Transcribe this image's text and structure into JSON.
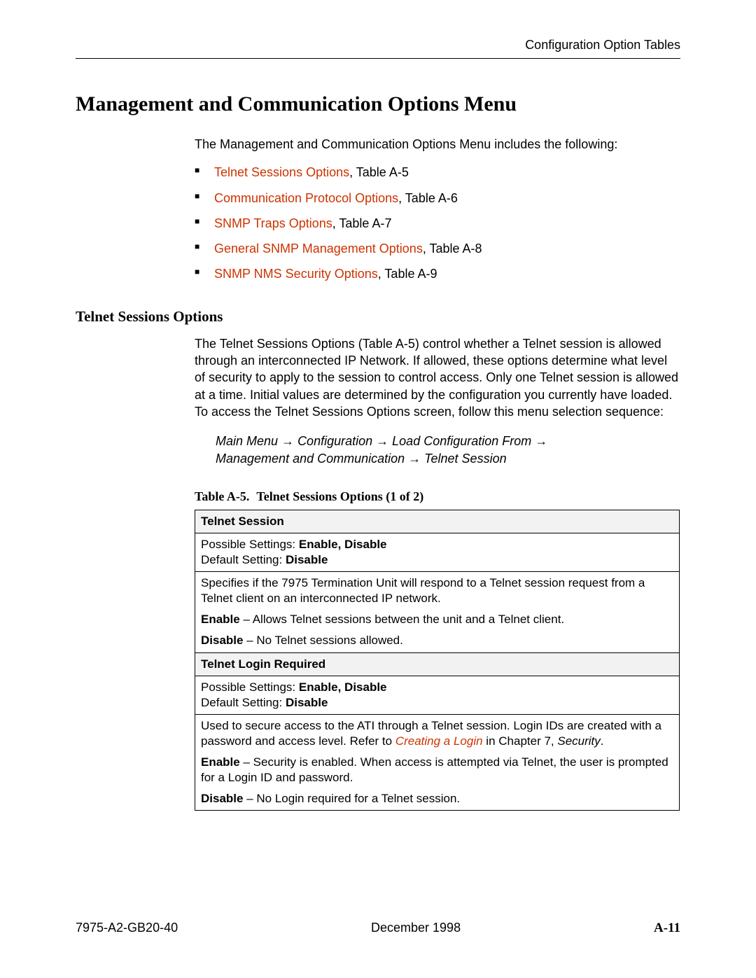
{
  "header": {
    "right": "Configuration Option Tables"
  },
  "title": "Management and Communication Options Menu",
  "intro": "The Management and Communication Options Menu includes the following:",
  "bullets": [
    {
      "link": "Telnet Sessions Options",
      "rest": ", Table A-5"
    },
    {
      "link": "Communication Protocol Options",
      "rest": ", Table A-6"
    },
    {
      "link": "SNMP Traps Options",
      "rest": ", Table A-7"
    },
    {
      "link": "General SNMP Management Options",
      "rest": ", Table A-8"
    },
    {
      "link": "SNMP NMS Security Options",
      "rest": ", Table A-9"
    }
  ],
  "section": {
    "title": "Telnet Sessions Options",
    "para": "The Telnet Sessions Options (Table A-5) control whether a Telnet session is allowed through an interconnected IP Network. If allowed, these options determine what level of security to apply to the session to control access. Only one Telnet session is allowed at a time. Initial values are determined by the configuration you currently have loaded. To access the Telnet Sessions Options screen, follow this menu selection sequence:",
    "path": {
      "seg1": "Main Menu ",
      "seg2": "Configuration ",
      "seg3": "Load Configuration From ",
      "seg4": "Management and Communication ",
      "seg5": "Telnet Session"
    }
  },
  "table": {
    "caption_num": "Table A-5.",
    "caption_title": "Telnet Sessions Options (1 of 2)",
    "row1_heading": "Telnet Session",
    "row1_possible_label": "Possible Settings: ",
    "row1_possible_value": "Enable, Disable",
    "row1_default_label": "Default Setting: ",
    "row1_default_value": "Disable",
    "row1_desc": "Specifies if the 7975 Termination Unit will respond to a Telnet session request from a Telnet client on an interconnected IP network.",
    "row1_enable_label": "Enable",
    "row1_enable_text": " – Allows Telnet sessions between the unit and a Telnet client.",
    "row1_disable_label": "Disable",
    "row1_disable_text": " – No Telnet sessions allowed.",
    "row2_heading": "Telnet Login Required",
    "row2_possible_label": "Possible Settings: ",
    "row2_possible_value": "Enable, Disable",
    "row2_default_label": "Default Setting: ",
    "row2_default_value": "Disable",
    "row2_desc_pre": "Used to secure access to the ATI through a Telnet session. Login IDs are created with a password and access level. Refer to ",
    "row2_desc_link": "Creating a Login",
    "row2_desc_mid": " in Chapter 7, ",
    "row2_desc_ital": "Security",
    "row2_desc_post": ".",
    "row2_enable_label": "Enable",
    "row2_enable_text": " – Security is enabled. When access is attempted via Telnet, the user is prompted for a Login ID and password.",
    "row2_disable_label": "Disable",
    "row2_disable_text": " – No Login required for a Telnet session."
  },
  "footer": {
    "left": "7975-A2-GB20-40",
    "center": "December 1998",
    "right": "A-11"
  }
}
